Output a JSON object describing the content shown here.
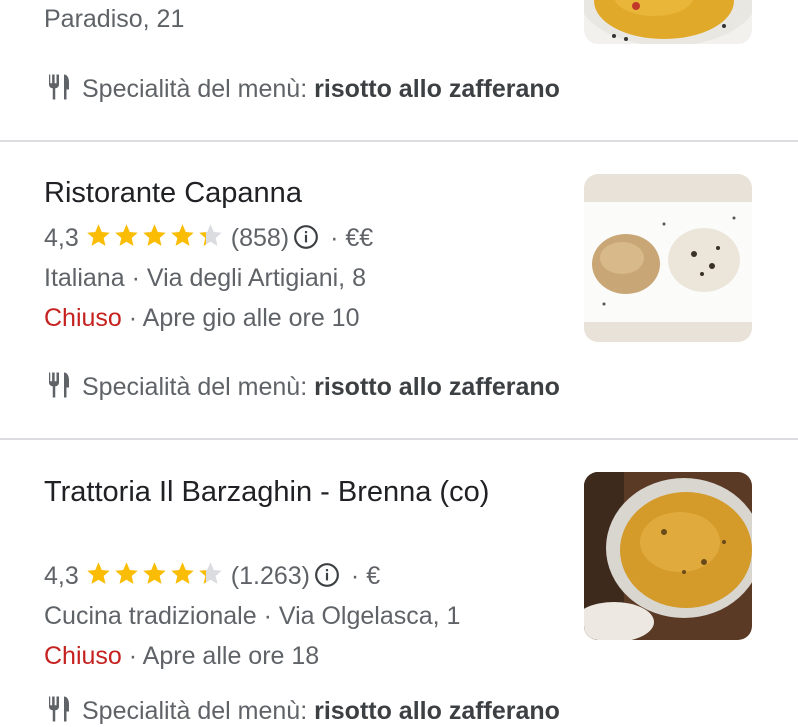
{
  "results": [
    {
      "address_line": "Paradiso, 21",
      "specialty_label": "Specialità del menù: ",
      "specialty_value": "risotto allo zafferano",
      "image": "saffron-risotto-plate-photo"
    },
    {
      "name": "Ristorante Capanna",
      "rating": "4,3",
      "rating_value": 4.3,
      "reviews": "(858)",
      "price": "€€",
      "category": "Italiana",
      "address": "Via degli Artigiani, 8",
      "status": "Chiuso",
      "hours": "Apre gio alle ore 10",
      "specialty_label": "Specialità del menù: ",
      "specialty_value": "risotto allo zafferano",
      "image": "pasta-and-risotto-plate-photo"
    },
    {
      "name": "Trattoria Il Barzaghin - Brenna (co)",
      "rating": "4,3",
      "rating_value": 4.3,
      "reviews": "(1.263)",
      "price": "€",
      "category": "Cucina tradizionale",
      "address": "Via Olgelasca, 1",
      "status": "Chiuso",
      "hours": "Apre alle ore 18",
      "specialty_label": "Specialità del menù: ",
      "specialty_value": "risotto allo zafferano",
      "image": "saffron-risotto-bowl-photo"
    }
  ],
  "separator": " · ",
  "colors": {
    "star": "#fbbc04",
    "closed": "#c5221f",
    "text_secondary": "#5f6368",
    "divider": "#dadce0"
  },
  "icons": [
    "utensils-icon",
    "star-icon",
    "info-icon"
  ]
}
